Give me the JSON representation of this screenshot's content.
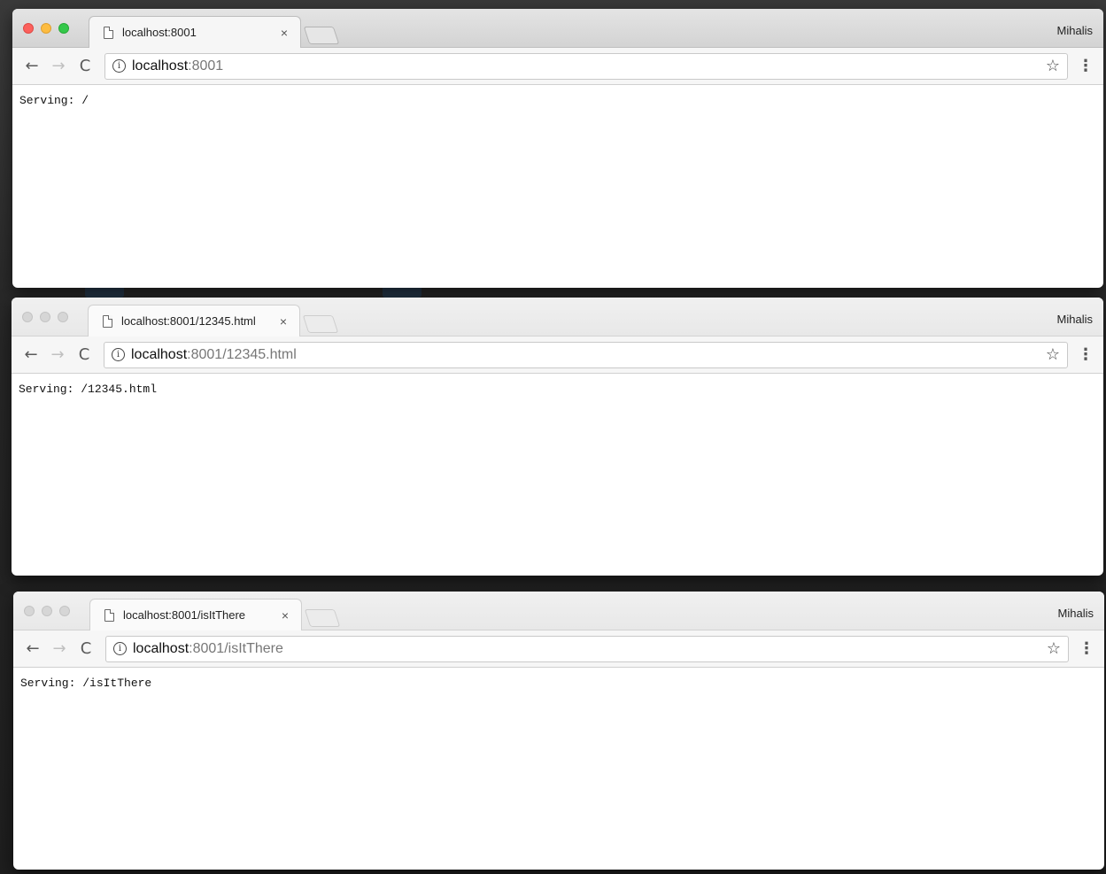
{
  "windows": [
    {
      "tab": {
        "title": "localhost:8001",
        "close": "×"
      },
      "profile": "Mihalis",
      "nav": {
        "back": "←",
        "forward": "→",
        "reload": "C"
      },
      "address": {
        "info": "i",
        "host": "localhost",
        "rest": ":8001"
      },
      "actions": {
        "bookmark": "☆",
        "menu": "⋮"
      },
      "content": "Serving: /",
      "active": true
    },
    {
      "tab": {
        "title": "localhost:8001/12345.html",
        "close": "×"
      },
      "profile": "Mihalis",
      "nav": {
        "back": "←",
        "forward": "→",
        "reload": "C"
      },
      "address": {
        "info": "i",
        "host": "localhost",
        "rest": ":8001/12345.html"
      },
      "actions": {
        "bookmark": "☆",
        "menu": "⋮"
      },
      "content": "Serving: /12345.html",
      "active": false
    },
    {
      "tab": {
        "title": "localhost:8001/isItThere",
        "close": "×"
      },
      "profile": "Mihalis",
      "nav": {
        "back": "←",
        "forward": "→",
        "reload": "C"
      },
      "address": {
        "info": "i",
        "host": "localhost",
        "rest": ":8001/isItThere"
      },
      "actions": {
        "bookmark": "☆",
        "menu": "⋮"
      },
      "content": "Serving: /isItThere",
      "active": false
    }
  ]
}
